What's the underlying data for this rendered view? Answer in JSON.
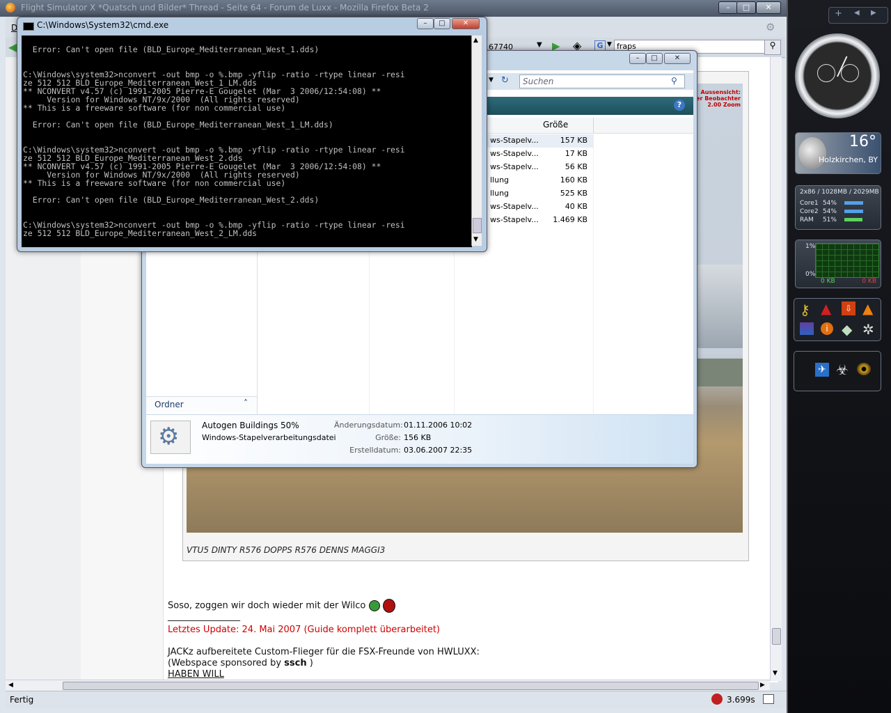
{
  "firefox": {
    "title": "Flight Simulator X *Quatsch und Bilder* Thread - Seite 64 - Forum de Luxx - Mozilla Firefox Beta 2",
    "menu_letter": "D",
    "url_fragment": "67740",
    "search_value": "fraps",
    "status_text": "Fertig",
    "status_timer": "3.699s"
  },
  "cmd": {
    "title": "C:\\Windows\\System32\\cmd.exe",
    "lines": [
      "",
      "  Error: Can't open file (BLD_Europe_Mediterranean_West_1.dds)",
      "",
      "",
      "C:\\Windows\\system32>nconvert -out bmp -o %.bmp -yflip -ratio -rtype linear -resi",
      "ze 512 512 BLD_Europe_Mediterranean_West_1_LM.dds",
      "** NCONVERT v4.57 (c) 1991-2005 Pierre-E Gougelet (Mar  3 2006/12:54:08) **",
      "     Version for Windows NT/9x/2000  (All rights reserved)",
      "** This is a freeware software (for non commercial use)",
      "",
      "  Error: Can't open file (BLD_Europe_Mediterranean_West_1_LM.dds)",
      "",
      "",
      "C:\\Windows\\system32>nconvert -out bmp -o %.bmp -yflip -ratio -rtype linear -resi",
      "ze 512 512 BLD_Europe_Mediterranean_West_2.dds",
      "** NCONVERT v4.57 (c) 1991-2005 Pierre-E Gougelet (Mar  3 2006/12:54:08) **",
      "     Version for Windows NT/9x/2000  (All rights reserved)",
      "** This is a freeware software (for non commercial use)",
      "",
      "  Error: Can't open file (BLD_Europe_Mediterranean_West_2.dds)",
      "",
      "",
      "C:\\Windows\\system32>nconvert -out bmp -o %.bmp -yflip -ratio -rtype linear -resi",
      "ze 512 512 BLD_Europe_Mediterranean_West_2_LM.dds"
    ]
  },
  "explorer": {
    "search_placeholder": "Suchen",
    "col_size": "Größe",
    "rows": [
      {
        "type": "ws-Stapelv...",
        "size": "157 KB"
      },
      {
        "type": "ws-Stapelv...",
        "size": "17 KB"
      },
      {
        "type": "ws-Stapelv...",
        "size": "56 KB"
      },
      {
        "type": "llung",
        "size": "160 KB"
      },
      {
        "type": "llung",
        "size": "525 KB"
      },
      {
        "type": "ws-Stapelv...",
        "size": "40 KB"
      },
      {
        "type": "ws-Stapelv...",
        "size": "1.469 KB"
      }
    ],
    "folder_label": "Ordner",
    "details": {
      "name": "Autogen Buildings 50%",
      "kind": "Windows-Stapelverarbeitungsdatei",
      "modified_label": "Änderungsdatum:",
      "modified_value": "01.11.2006 10:02",
      "size_label": "Größe:",
      "size_value": "156 KB",
      "created_label": "Erstelldatum:",
      "created_value": "03.06.2007 22:35"
    }
  },
  "forum": {
    "overlay_lines": [
      "Aussensicht:",
      "ster Beobachter",
      "2.00 Zoom"
    ],
    "caption": "VTU5 DINTY R576 DOPPS R576 DENNS MAGGI3",
    "post_line": "Soso, zoggen wir doch wieder mit der Wilco",
    "divider": "________________",
    "update_line": "Letztes Update: 24. Mai 2007 (Guide komplett überarbeitet)",
    "jackz_line": "JACKz aufbereitete Custom-Flieger für die FSX-Freunde von HWLUXX:",
    "webspace_prefix": "(Webspace sponsored by ",
    "webspace_name": "ssch",
    "webspace_suffix": " )",
    "haben_will": "HABEN WILL"
  },
  "sidebar": {
    "weather_temp": "16°",
    "weather_city": "Holzkirchen, BY",
    "cpu_header": "2x86 / 1028MB / 2029MB",
    "meters": [
      {
        "label": "Core1",
        "value": "54%",
        "level": 54
      },
      {
        "label": "Core2",
        "value": "54%",
        "level": 54
      },
      {
        "label": "RAM",
        "value": "51%",
        "level": 51
      }
    ],
    "net_top": "1%",
    "net_bottom": "0%",
    "net_in": "0 KB",
    "net_out": "0 KB",
    "launcher_icons": [
      "key-icon",
      "acrobat-icon",
      "120x-icon",
      "download-icon",
      "vlc-icon",
      "winrar-icon",
      "info-icon",
      "diamond-icon",
      "compass-icon"
    ],
    "dock_icons": [
      "plane-icon",
      "game-icon",
      "eye-icon"
    ]
  },
  "colors": {
    "update_red": "#d00000",
    "cmd_text": "#c0c0c0",
    "sidebar_bg": "#0a0a0c"
  }
}
